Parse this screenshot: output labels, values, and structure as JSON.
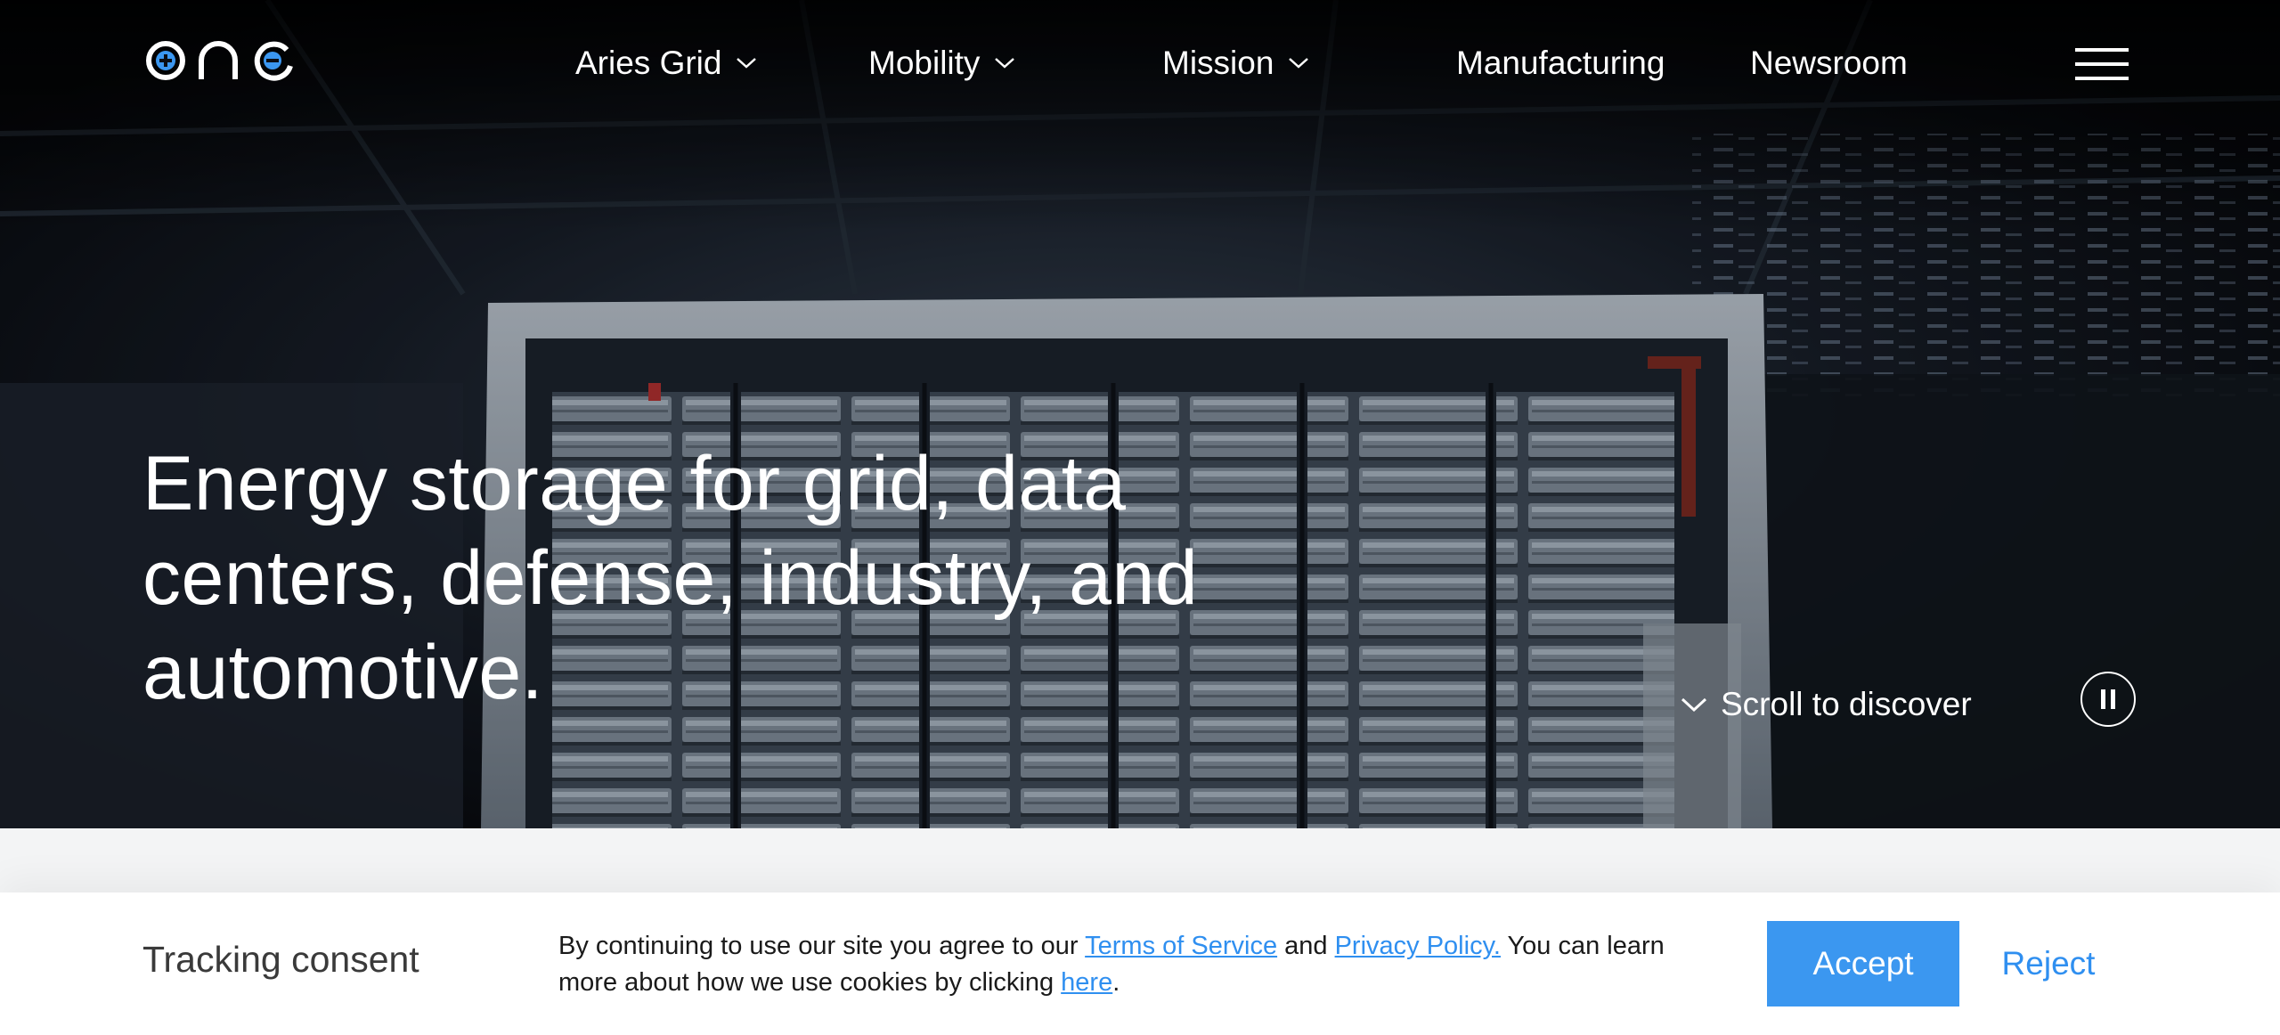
{
  "brand": {
    "logo_text": "one",
    "accent": "#3b97f0"
  },
  "nav": {
    "items": [
      {
        "label": "Aries Grid",
        "has_dropdown": true
      },
      {
        "label": "Mobility",
        "has_dropdown": true
      },
      {
        "label": "Mission",
        "has_dropdown": true
      },
      {
        "label": "Manufacturing",
        "has_dropdown": false
      },
      {
        "label": "Newsroom",
        "has_dropdown": false
      }
    ],
    "menu_icon": "hamburger-icon",
    "dropdown_icon": "chevron-down-icon"
  },
  "hero": {
    "headline": "Energy storage for grid, data centers, defense, industry, and automotive.",
    "scroll_label": "Scroll to discover",
    "scroll_icon": "chevron-down-icon",
    "video_control_icon": "pause-icon"
  },
  "consent": {
    "title": "Tracking consent",
    "text_before": "By continuing to use our site you agree to our ",
    "terms_link": "Terms of Service",
    "text_and": " and ",
    "privacy_link": "Privacy Policy.",
    "text_middle": " You can learn more about how we use cookies by clicking ",
    "here_link": "here",
    "text_end": ".",
    "accept_label": "Accept",
    "reject_label": "Reject",
    "link_color": "#2f8ff0",
    "accept_color": "#3b97f0"
  }
}
